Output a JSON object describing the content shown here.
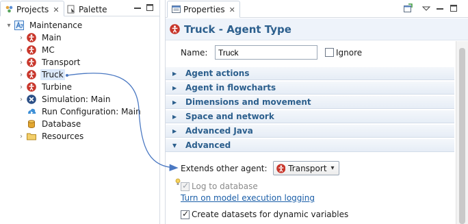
{
  "left_panel": {
    "tabs": [
      {
        "label": "Projects",
        "icon": "projects-icon",
        "active": true
      },
      {
        "label": "Palette",
        "icon": "palette-icon",
        "active": false
      }
    ],
    "tree": {
      "root": {
        "label": "Maintenance",
        "icon": "model-icon"
      },
      "items": [
        {
          "label": "Main",
          "icon": "agent-type-icon"
        },
        {
          "label": "MC",
          "icon": "agent-type-icon"
        },
        {
          "label": "Transport",
          "icon": "agent-type-icon"
        },
        {
          "label": "Truck",
          "icon": "agent-type-icon",
          "selected": true
        },
        {
          "label": "Turbine",
          "icon": "agent-type-icon"
        },
        {
          "label": "Simulation: Main",
          "icon": "simulation-icon"
        },
        {
          "label": "Run Configuration: Main",
          "icon": "run-config-icon"
        },
        {
          "label": "Database",
          "icon": "database-icon"
        },
        {
          "label": "Resources",
          "icon": "folder-icon"
        }
      ]
    }
  },
  "right_panel": {
    "tab": {
      "label": "Properties",
      "icon": "properties-icon"
    },
    "header": {
      "title": "Truck - Agent Type",
      "icon": "agent-type-icon"
    },
    "name_field": {
      "label": "Name:",
      "value": "Truck"
    },
    "ignore": {
      "label": "Ignore",
      "checked": false
    },
    "sections": [
      {
        "label": "Agent actions",
        "expanded": false
      },
      {
        "label": "Agent in flowcharts",
        "expanded": false
      },
      {
        "label": "Dimensions and movement",
        "expanded": false
      },
      {
        "label": "Space and network",
        "expanded": false
      },
      {
        "label": "Advanced Java",
        "expanded": false
      },
      {
        "label": "Advanced",
        "expanded": true
      }
    ],
    "extends": {
      "label": "Extends other agent:",
      "value": "Transport"
    },
    "log_to_database": {
      "label": "Log to database",
      "checked": true,
      "enabled": false
    },
    "logging_link": "Turn on model execution logging",
    "create_datasets": {
      "label": "Create datasets for dynamic variables",
      "checked": true
    }
  },
  "colors": {
    "accent": "#2c5f8d",
    "agent_icon": "#c8362b",
    "selection": "#dbe9fb",
    "arrow": "#4a78c2",
    "link": "#1a5ea8"
  }
}
